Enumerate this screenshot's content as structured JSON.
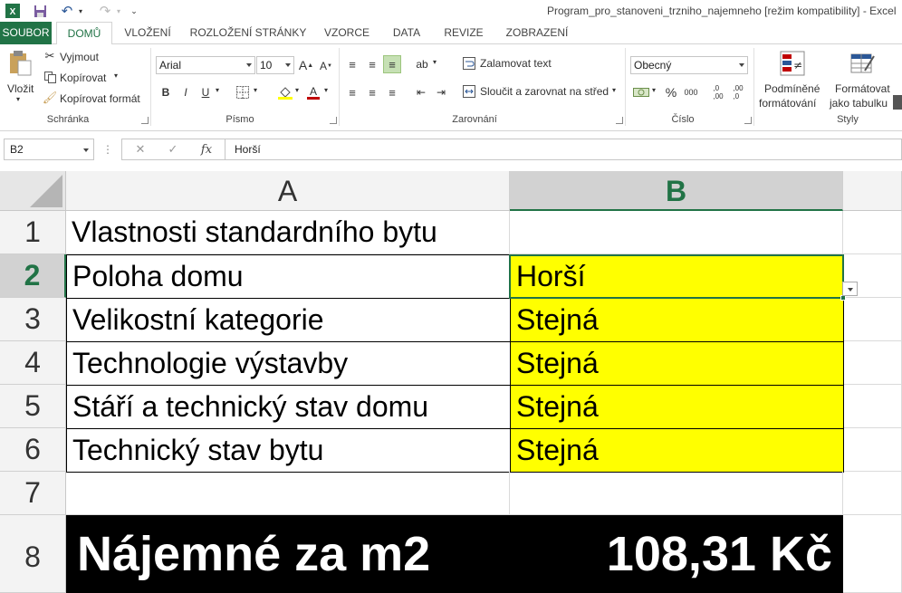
{
  "title": "Program_pro_stanoveni_trzniho_najemneho  [režim kompatibility] - Excel",
  "tabs": [
    "SOUBOR",
    "DOMŮ",
    "VLOŽENÍ",
    "ROZLOŽENÍ STRÁNKY",
    "VZORCE",
    "DATA",
    "REVIZE",
    "ZOBRAZENÍ"
  ],
  "active_tab": "DOMŮ",
  "ribbon": {
    "clipboard": {
      "paste": "Vložit",
      "cut": "Vyjmout",
      "copy": "Kopírovat",
      "format_painter": "Kopírovat formát",
      "label": "Schránka"
    },
    "font": {
      "font_name": "Arial",
      "font_size": "10",
      "bold": "B",
      "italic": "I",
      "underline": "U",
      "label": "Písmo"
    },
    "alignment": {
      "wrap_text": "Zalamovat text",
      "merge_center": "Sloučit a zarovnat na střed",
      "label": "Zarovnání"
    },
    "number": {
      "format": "Obecný",
      "percent": "%",
      "thousands": "000",
      "label": "Číslo"
    },
    "styles": {
      "conditional_l1": "Podmíněné",
      "conditional_l2": "formátování",
      "table_l1": "Formátovat",
      "table_l2": "jako tabulku",
      "label": "Styly"
    }
  },
  "formula_bar": {
    "name_box": "B2",
    "cancel": "✕",
    "enter": "✓",
    "fx": "fx",
    "content": "Horší"
  },
  "columns": [
    "A",
    "B"
  ],
  "selected_column": "B",
  "rows": [
    {
      "num": "1",
      "a": "Vlastnosti standardního bytu",
      "b": ""
    },
    {
      "num": "2",
      "a": "Poloha domu",
      "b": "Horší"
    },
    {
      "num": "3",
      "a": "Velikostní kategorie",
      "b": "Stejná"
    },
    {
      "num": "4",
      "a": "Technologie výstavby",
      "b": "Stejná"
    },
    {
      "num": "5",
      "a": "Stáří a technický stav domu",
      "b": "Stejná"
    },
    {
      "num": "6",
      "a": "Technický stav bytu",
      "b": "Stejná"
    },
    {
      "num": "7",
      "a": "",
      "b": ""
    },
    {
      "num": "8",
      "a": "Nájemné za m2",
      "b": "108,31 Kč"
    }
  ],
  "selected_row": "2",
  "colors": {
    "accent": "#217346",
    "highlight": "#ffff00",
    "result_bg": "#000000",
    "result_text": "#ffffff"
  }
}
